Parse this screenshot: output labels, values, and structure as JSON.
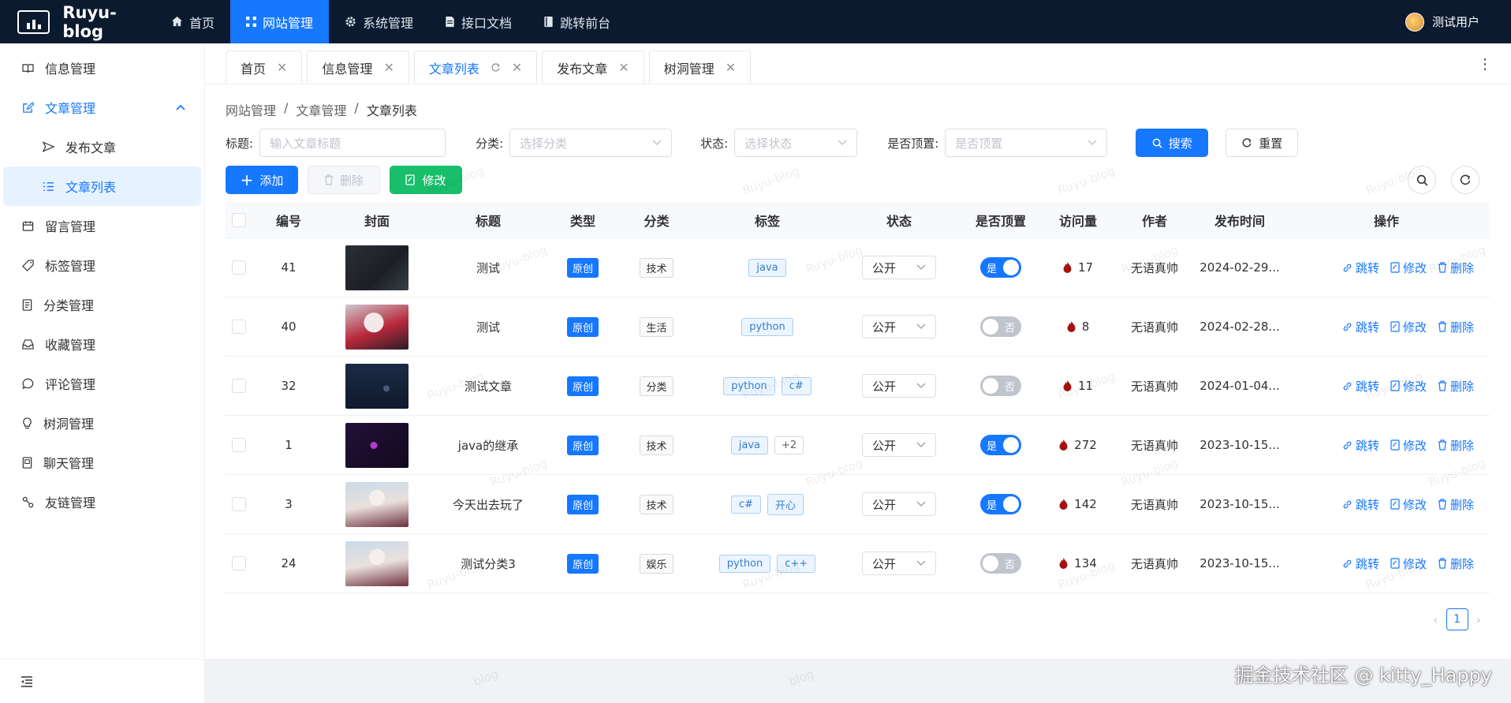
{
  "brand": {
    "name": "Ruyu-blog"
  },
  "topmenu": [
    {
      "label": "首页",
      "icon": "home-icon"
    },
    {
      "label": "网站管理",
      "icon": "grid-icon",
      "active": true
    },
    {
      "label": "系统管理",
      "icon": "gear-icon"
    },
    {
      "label": "接口文档",
      "icon": "document-icon"
    },
    {
      "label": "跳转前台",
      "icon": "book-icon"
    }
  ],
  "user": {
    "name": "测试用户"
  },
  "sidebar": {
    "items": [
      {
        "label": "信息管理"
      },
      {
        "label": "文章管理"
      },
      {
        "label": "发布文章"
      },
      {
        "label": "文章列表"
      },
      {
        "label": "留言管理"
      },
      {
        "label": "标签管理"
      },
      {
        "label": "分类管理"
      },
      {
        "label": "收藏管理"
      },
      {
        "label": "评论管理"
      },
      {
        "label": "树洞管理"
      },
      {
        "label": "聊天管理"
      },
      {
        "label": "友链管理"
      }
    ]
  },
  "tabs": [
    {
      "label": "首页"
    },
    {
      "label": "信息管理"
    },
    {
      "label": "文章列表",
      "active": true
    },
    {
      "label": "发布文章"
    },
    {
      "label": "树洞管理"
    }
  ],
  "breadcrumb": [
    "网站管理",
    "文章管理",
    "文章列表"
  ],
  "filters": {
    "title_label": "标题:",
    "title_placeholder": "输入文章标题",
    "category_label": "分类:",
    "category_placeholder": "选择分类",
    "status_label": "状态:",
    "status_placeholder": "选择状态",
    "top_label": "是否顶置:",
    "top_placeholder": "是否顶置",
    "search_btn": "搜索",
    "reset_btn": "重置"
  },
  "actions": {
    "add": "添加",
    "delete": "删除",
    "edit": "修改"
  },
  "table": {
    "headers": [
      "编号",
      "封面",
      "标题",
      "类型",
      "分类",
      "标签",
      "状态",
      "是否顶置",
      "访问量",
      "作者",
      "发布时间",
      "操作"
    ],
    "rows": [
      {
        "id": "41",
        "title": "测试",
        "type": "原创",
        "category": "技术",
        "tags": [
          "java"
        ],
        "status": "公开",
        "top": true,
        "top_label": "是",
        "views": "17",
        "author": "无语真帅",
        "date": "2024-02-29...",
        "cover": "dark-code"
      },
      {
        "id": "40",
        "title": "测试",
        "type": "原创",
        "category": "生活",
        "tags": [
          "python"
        ],
        "status": "公开",
        "top": false,
        "top_label": "否",
        "views": "8",
        "author": "无语真帅",
        "date": "2024-02-28...",
        "cover": "anime-red"
      },
      {
        "id": "32",
        "title": "测试文章",
        "type": "原创",
        "category": "分类",
        "tags": [
          "python",
          "c#"
        ],
        "status": "公开",
        "top": false,
        "top_label": "否",
        "views": "11",
        "author": "无语真帅",
        "date": "2024-01-04...",
        "cover": "night-blue"
      },
      {
        "id": "1",
        "title": "java的继承",
        "type": "原创",
        "category": "技术",
        "tags": [
          "java",
          "+2"
        ],
        "status": "公开",
        "top": true,
        "top_label": "是",
        "views": "272",
        "author": "无语真帅",
        "date": "2023-10-15...",
        "cover": "dark-purple"
      },
      {
        "id": "3",
        "title": "今天出去玩了",
        "type": "原创",
        "category": "技术",
        "tags": [
          "c#",
          "开心"
        ],
        "status": "公开",
        "top": true,
        "top_label": "是",
        "views": "142",
        "author": "无语真帅",
        "date": "2023-10-15...",
        "cover": "anime-light"
      },
      {
        "id": "24",
        "title": "测试分类3",
        "type": "原创",
        "category": "娱乐",
        "tags": [
          "python",
          "c++"
        ],
        "status": "公开",
        "top": false,
        "top_label": "否",
        "views": "134",
        "author": "无语真帅",
        "date": "2023-10-15...",
        "cover": "anime-light"
      }
    ],
    "ops": {
      "jump": "跳转",
      "edit": "修改",
      "delete": "删除"
    }
  },
  "pagination": {
    "current": "1"
  },
  "watermark": {
    "text": "Ruyu-blog",
    "partial": "blog"
  },
  "credit": "掘金技术社区 @ kitty_Happy"
}
